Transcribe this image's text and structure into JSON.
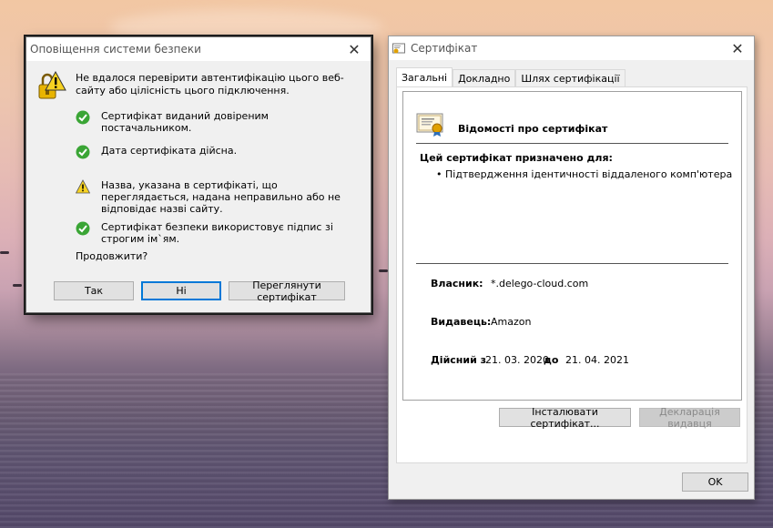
{
  "alert": {
    "title": "Оповіщення системи безпеки",
    "message": "Не вдалося перевірити автентифікацію цього веб-сайту або цілісність цього підключення.",
    "checks": [
      {
        "status": "ok",
        "icon": "green-check-icon",
        "text": "Сертифікат виданий довіреним постачальником."
      },
      {
        "status": "ok",
        "icon": "green-check-icon",
        "text": "Дата сертифіката дійсна."
      },
      {
        "status": "warning",
        "icon": "warning-triangle-icon",
        "text": "Назва, указана в сертифікаті, що переглядається, надана неправильно або не відповідає назві сайту."
      },
      {
        "status": "ok",
        "icon": "green-check-icon",
        "text": "Сертифікат безпеки використовує підпис зі строгим ім`ям."
      }
    ],
    "question": "Продовжити?",
    "buttons": {
      "yes": "Так",
      "no": "Ні",
      "view": "Переглянути сертифікат"
    }
  },
  "certificate": {
    "title": "Сертифікат",
    "tabs": [
      {
        "label": "Загальні",
        "active": true
      },
      {
        "label": "Докладно",
        "active": false
      },
      {
        "label": "Шлях сертифікації",
        "active": false
      }
    ],
    "info_title": "Відомості про сертифікат",
    "purpose_title": "Цей сертифікат призначено для:",
    "purposes": [
      "• Підтвердження ідентичності віддаленого комп'ютера"
    ],
    "issued_to_label": "Власник:",
    "issued_to": "*.delego-cloud.com",
    "issuer_label": "Видавець:",
    "issuer": "Amazon",
    "valid_label": "Дійсний з",
    "valid_from": "21. 03. 2020",
    "valid_to_label": "до",
    "valid_to": "21. 04. 2021",
    "buttons": {
      "install": "Інсталювати сертифікат...",
      "statement": "Декларація видавця",
      "ok": "OK"
    }
  },
  "colors": {
    "accent": "#0078d7",
    "ok_green": "#3aa535",
    "warning_yellow": "#f7d221"
  }
}
